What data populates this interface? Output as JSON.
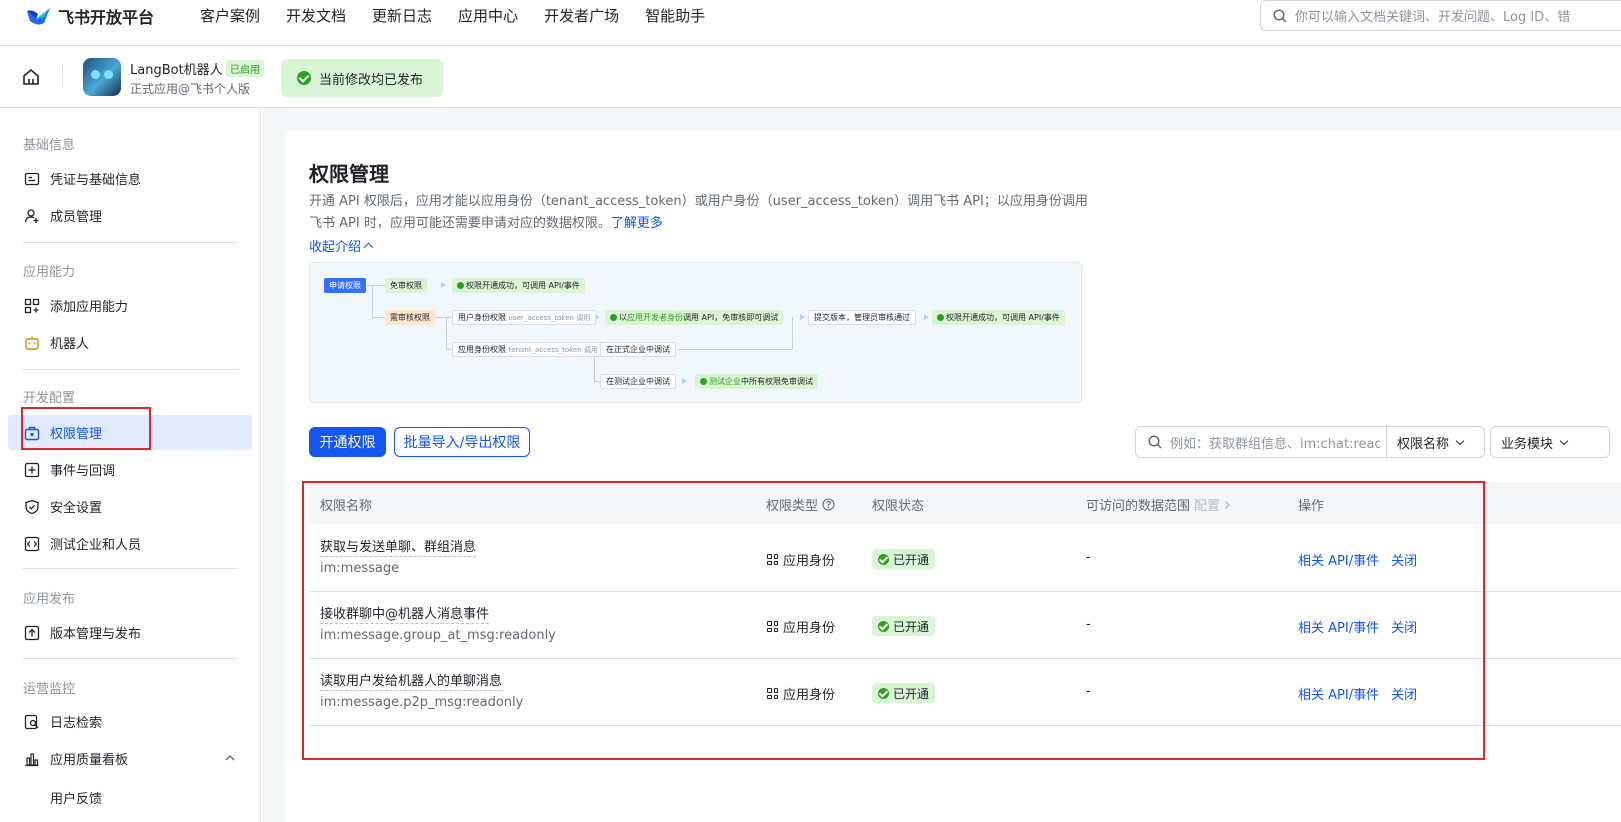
{
  "topnav": {
    "logo": "飞书开放平台",
    "items": [
      "客户案例",
      "开发文档",
      "更新日志",
      "应用中心",
      "开发者广场",
      "智能助手"
    ],
    "search_placeholder": "你可以输入文档关键词、开发问题、Log ID、错"
  },
  "app": {
    "name": "LangBot机器人",
    "badge": "已启用",
    "subtitle": "正式应用@飞书个人版",
    "publish_status": "当前修改均已发布"
  },
  "sidebar": {
    "sections": [
      {
        "title": "基础信息",
        "items": [
          "凭证与基础信息",
          "成员管理"
        ]
      },
      {
        "title": "应用能力",
        "items": [
          "添加应用能力",
          "机器人"
        ]
      },
      {
        "title": "开发配置",
        "items": [
          "权限管理",
          "事件与回调",
          "安全设置",
          "测试企业和人员"
        ]
      },
      {
        "title": "应用发布",
        "items": [
          "版本管理与发布"
        ]
      },
      {
        "title": "运营监控",
        "items": [
          "日志检索",
          "应用质量看板",
          "用户反馈"
        ]
      }
    ],
    "active": "权限管理"
  },
  "main": {
    "title": "权限管理",
    "desc_text": "开通 API 权限后，应用才能以应用身份（tenant_access_token）或用户身份（user_access_token）调用飞书 API；以应用身份调用飞书 API 时，应用可能还需要申请对应的数据权限。",
    "learn_more": "了解更多",
    "collapse": "收起介绍",
    "diagram": {
      "apply": "申请权限",
      "no_review": "免审权限",
      "success_1": "权限开通成功，可调用 API/事件",
      "need_review": "需审核权限",
      "user_perm": "用户身份权限",
      "user_token": "user_access_token 调用",
      "dev_identity_pre": "以",
      "dev_identity_green": "应用开发者身份",
      "dev_identity_post": "调用 API，免审核即可调试",
      "submit": "提交版本，管理员审核通过",
      "success_2": "权限开通成功，可调用 API/事件",
      "app_perm": "应用身份权限",
      "tenant_token": "tenant_access_token 调用",
      "prod_debug": "在正式企业中调试",
      "test_debug": "在测试企业中调试",
      "test_all_green": "测试企业",
      "test_all_post": "中所有权限免审调试"
    },
    "btn_enable": "开通权限",
    "btn_batch": "批量导入/导出权限",
    "filter_placeholder": "例如：获取群组信息、im:chat:readonly",
    "filter_select": "权限名称",
    "filter_module": "业务模块"
  },
  "table": {
    "headers": {
      "name": "权限名称",
      "type": "权限类型",
      "status": "权限状态",
      "scope": "可访问的数据范围",
      "scope_config": "配置",
      "ops": "操作"
    },
    "rows": [
      {
        "name": "获取与发送单聊、群组消息",
        "code": "im:message",
        "type": "应用身份",
        "status": "已开通",
        "scope": "-",
        "op_api": "相关 API/事件",
        "op_close": "关闭"
      },
      {
        "name": "接收群聊中@机器人消息事件",
        "code": "im:message.group_at_msg:readonly",
        "type": "应用身份",
        "status": "已开通",
        "scope": "-",
        "op_api": "相关 API/事件",
        "op_close": "关闭"
      },
      {
        "name": "读取用户发给机器人的单聊消息",
        "code": "im:message.p2p_msg:readonly",
        "type": "应用身份",
        "status": "已开通",
        "scope": "-",
        "op_api": "相关 API/事件",
        "op_close": "关闭"
      }
    ]
  },
  "colors": {
    "accent": "#1456f0",
    "success_bg": "#d9f5d6",
    "success": "#2ea121",
    "annotation": "#e0262a"
  }
}
